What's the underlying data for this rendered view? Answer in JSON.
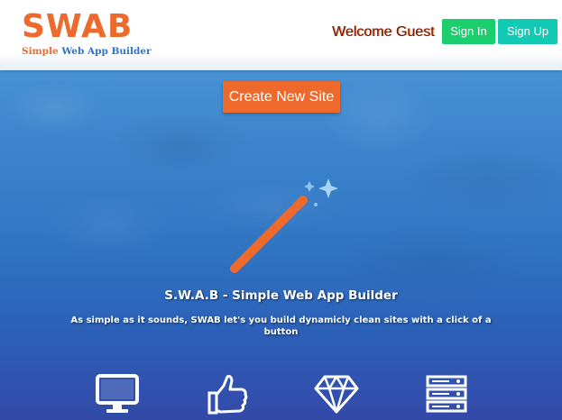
{
  "header": {
    "logo_title": "SWAB",
    "logo_subtitle_part1": "Simple",
    "logo_subtitle_part2": "Web App Builder",
    "welcome_text": "Welcome Guest",
    "signin_label": "Sign In",
    "signup_label": "Sign Up"
  },
  "main": {
    "create_button_label": "Create New Site",
    "hero_title": "S.W.A.B - Simple Web App Builder",
    "hero_subtitle": "As simple as it sounds, SWAB let's you build dynamicly clean sites with a click of a button",
    "features": [
      {
        "icon": "desktop-icon"
      },
      {
        "icon": "thumbs-up-icon"
      },
      {
        "icon": "diamond-icon"
      },
      {
        "icon": "server-icon"
      }
    ]
  },
  "colors": {
    "brand_orange": "#ee6a2c",
    "brand_blue": "#2d73c9",
    "signin_green": "#1bcf6e",
    "signup_teal": "#12c9b4"
  }
}
